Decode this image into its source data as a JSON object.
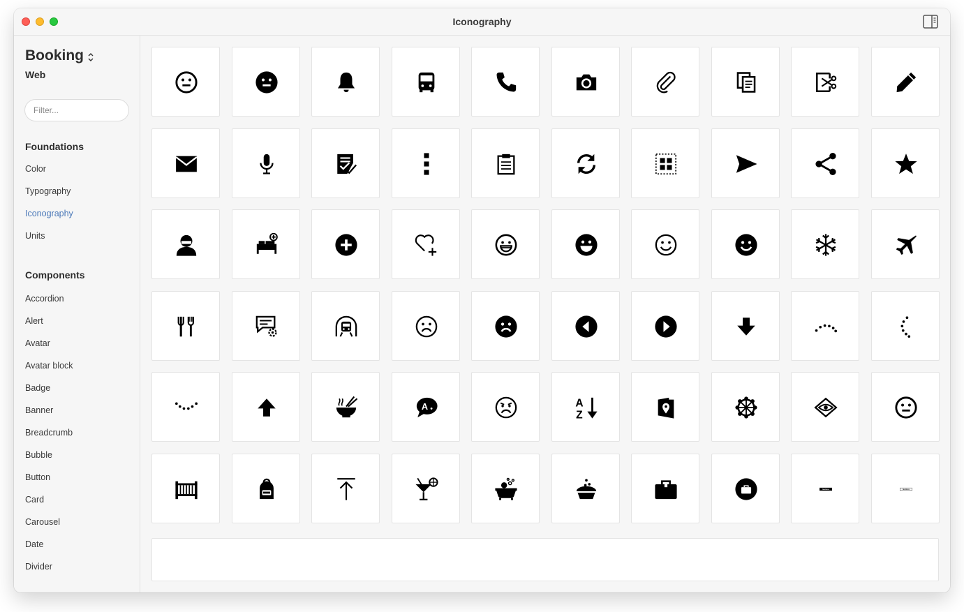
{
  "window": {
    "title": "Iconography"
  },
  "sidebar": {
    "brand": "Booking",
    "platform": "Web",
    "filter_placeholder": "Filter...",
    "sections": [
      {
        "title": "Foundations",
        "items": [
          "Color",
          "Typography",
          "Iconography",
          "Units"
        ],
        "active": "Iconography"
      },
      {
        "title": "Components",
        "items": [
          "Accordion",
          "Alert",
          "Avatar",
          "Avatar block",
          "Badge",
          "Banner",
          "Breadcrumb",
          "Bubble",
          "Button",
          "Card",
          "Carousel",
          "Date",
          "Divider"
        ]
      }
    ]
  },
  "icons": [
    [
      "face-neutral-outline-icon",
      "face-neutral-filled-icon",
      "bell-icon",
      "bus-icon",
      "phone-icon",
      "camera-icon",
      "paperclip-icon",
      "copy-document-icon",
      "cut-icon",
      "pencil-icon"
    ],
    [
      "envelope-icon",
      "microphone-icon",
      "checklist-icon",
      "more-vertical-icon",
      "clipboard-icon",
      "refresh-icon",
      "select-area-icon",
      "send-icon",
      "share-icon",
      "star-icon"
    ],
    [
      "person-icon",
      "bed-add-icon",
      "plus-circle-icon",
      "heart-add-icon",
      "face-grin-outline-icon",
      "face-grin-filled-icon",
      "face-smile-outline-icon",
      "face-smile-filled-icon",
      "snowflake-icon",
      "airplane-icon"
    ],
    [
      "restaurant-icon",
      "chat-settings-icon",
      "metro-icon",
      "face-sad-outline-icon",
      "face-sad-filled-icon",
      "arrow-left-circle-icon",
      "arrow-right-circle-icon",
      "arrow-down-icon",
      "loading-dots-arc-icon",
      "loading-dots-side-icon"
    ],
    [
      "loading-dots-bottom-icon",
      "arrow-up-icon",
      "noodle-bowl-icon",
      "translate-chat-icon",
      "face-angry-icon",
      "sort-az-icon",
      "map-pin-guide-icon",
      "ferris-wheel-icon",
      "eye-diamond-icon",
      "face-neutral-outline-alt-icon"
    ],
    [
      "crib-icon",
      "backpack-icon",
      "arrow-to-top-icon",
      "cocktail-icon",
      "bathtub-icon",
      "dessert-icon",
      "briefcase-icon",
      "briefcase-circle-icon",
      "business-badge-filled-icon",
      "business-badge-outline-icon"
    ]
  ],
  "badge_text": "business"
}
